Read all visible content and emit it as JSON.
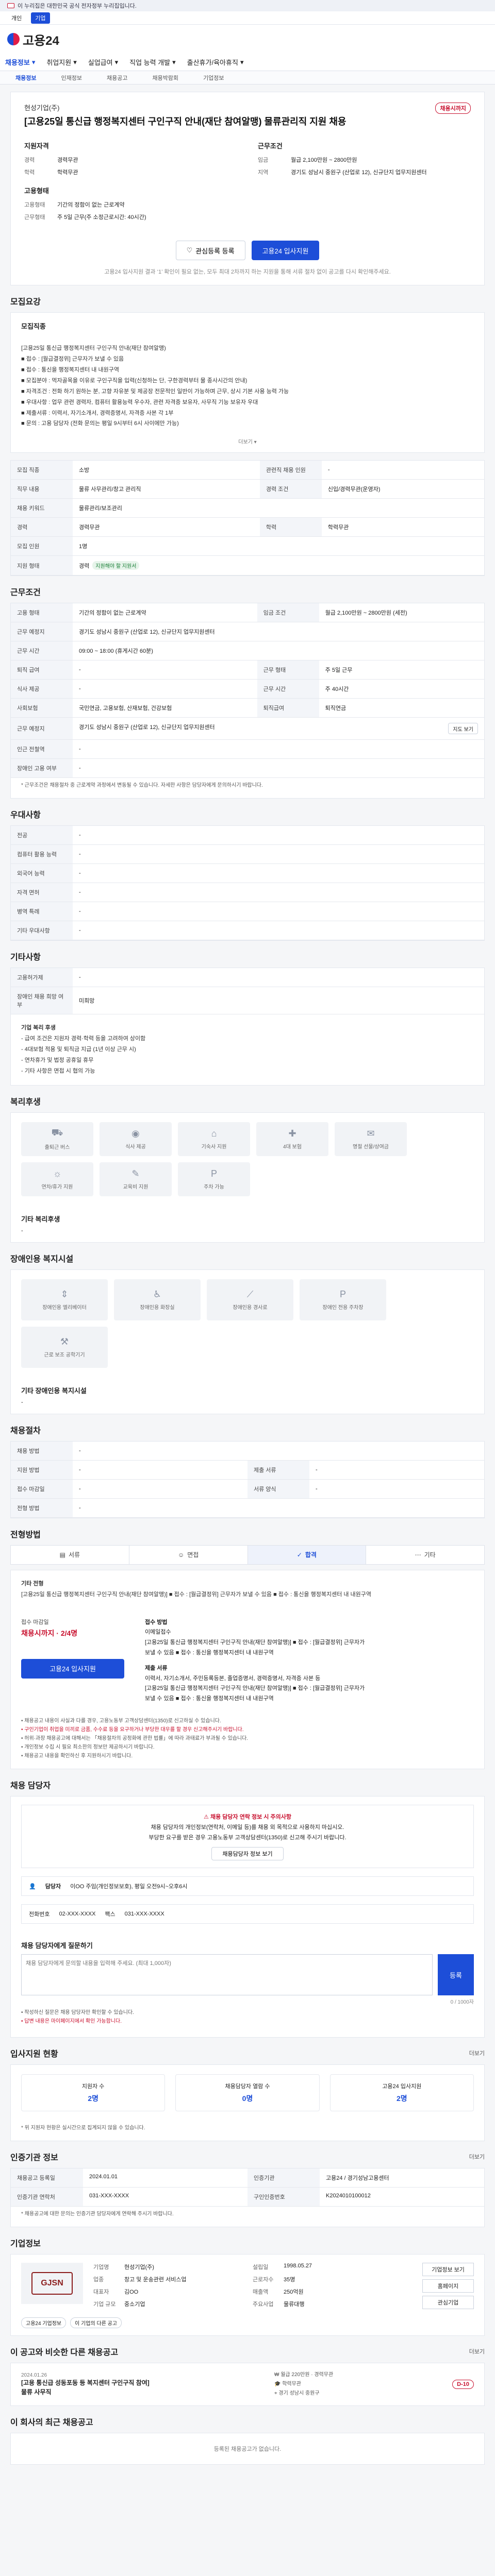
{
  "gov_bar": {
    "text": "이 누리집은 대한민국 공식 전자정부 누리집입니다."
  },
  "top_links": [
    {
      "label": "개인",
      "active": false
    },
    {
      "label": "기업",
      "active": true
    }
  ],
  "header": {
    "logo": "고용24"
  },
  "gnb": {
    "items": [
      "채용정보",
      "취업지원",
      "실업급여",
      "직업 능력 개발",
      "출산휴가/육아휴직"
    ],
    "active_index": 0
  },
  "snb": {
    "items": [
      "채용정보",
      "인재정보",
      "채용공고",
      "채용박람회",
      "기업정보"
    ],
    "active_index": 0
  },
  "job": {
    "company": "현성기업(주)",
    "title": "[고용25일 통신급 행정복지센터 구인구직 안내(재단 참여알맹) 물류관리직 지원 채용",
    "dday": "채용시까지",
    "apply_label": "지원자격",
    "career": {
      "k": "경력",
      "v": "경력무관"
    },
    "education": {
      "k": "학력",
      "v": "학력무관"
    },
    "cond_label": "근무조건",
    "pay": {
      "k": "임금",
      "v": "월급 2,100만원 ~ 2800만원"
    },
    "region": {
      "k": "지역",
      "v": "경기도 성남시 중원구 (산업로 12), 신규단지 업무지원센터"
    },
    "worktype_label": "고용형태",
    "worktype": {
      "k": "고용형태",
      "v": "기간의 정함이 없는 근로계약"
    },
    "hours": {
      "k": "근무형태",
      "v": "주 5일 근무(주 소정근로시간: 40시간)"
    },
    "bookmark_btn": "관심등록 등록",
    "apply_btn": "고용24 입사지원",
    "note": "고용24 입사지원 결과 ‘1’ 확인이 필요 없는, 모두 최대 2차까지 하는 지원을 통해 서류 절차 없이 공고를 다시 확인해주세요."
  },
  "recruit": {
    "section_title": "모집요강",
    "field_label": "모집직종",
    "body": [
      "[고용25일 통신급 행정복지센터 구인구직 안내(재단 참여알맹)",
      "■ 접수 : [월급결정위] 근무자가 보낼 수 있음",
      "■ 접수 : 통신을 행정복지센터 내 내원구역",
      "■ 모집분야 : 먹자골목을 이유로 구인구직을 입력(신청하는 단, 구한경력부터 물 종사시간의 안내)",
      "■ 자격조건 : 전화 하기 원하는 분, 고향 자유분 및 제공장 전문적인 일반이 가능하며 근무, 상시 기본 사용 능력 가능",
      "■ 우대사항 : 업무 관련 경력자, 컴퓨터 활용능력 우수자, 관련 자격증 보유자, 사무직 기능 보유자 우대",
      "■ 제출서류 : 이력서, 자기소개서, 경력증명서, 자격증 사본 각 1부",
      "■ 문의 : 고용 담당자 (전화 문의는 평일 9시부터 6시 사이에만 가능)"
    ],
    "more_btn": "더보기"
  },
  "recruit_table": {
    "rows": [
      {
        "k1": "모집 직종",
        "v1": "소방",
        "k2": "관련직 채용 인원",
        "v2": "-"
      },
      {
        "k1": "직무 내용",
        "v1": "물류 사무관리/창고 관리직",
        "k2": "경력 조건",
        "v2": "신입/경력무관(운영자)"
      },
      {
        "k1": "채용 키워드",
        "v1": "물류관리/보조관리",
        "k2": "",
        "v2": ""
      },
      {
        "k1": "경력",
        "v1": "경력무관",
        "k2": "학력",
        "v2": "학력무관"
      },
      {
        "k1": "모집 인원",
        "v1": "1명",
        "k2": "",
        "v2": ""
      },
      {
        "k1": "지원 형태",
        "v1": "경력",
        "k2": "",
        "v2": "",
        "tag": "지원해야 할 지원서"
      }
    ]
  },
  "conditions": {
    "section_title": "근무조건",
    "rows": [
      {
        "k1": "고용 형태",
        "v1": "기간의 정함이 없는 근로계약",
        "k2": "임금 조건",
        "v2": "월급 2,100만원 ~ 2800만원 (세전)"
      },
      {
        "k1": "근무 예정지",
        "v1": "경기도 성남시 중원구 (산업로 12), 신규단지 업무지원센터",
        "k2": "",
        "v2": ""
      },
      {
        "k1": "근무 시간",
        "v1": "09:00 ~ 18:00 (휴게시간 60분)",
        "k2": "",
        "v2": ""
      },
      {
        "k1": "퇴직 급여",
        "v1": "-",
        "k2": "근무 형태",
        "v2": "주 5일 근무"
      },
      {
        "k1": "식사 제공",
        "v1": "-",
        "k2": "근무 시간",
        "v2": "주 40시간"
      },
      {
        "k1": "사회보험",
        "v1": "국민연금, 고용보험, 산재보험, 건강보험",
        "k2": "퇴직급여",
        "v2": "퇴직연금"
      },
      {
        "k1": "근무 예정지",
        "v1": "경기도 성남시 중원구 (산업로 12), 신규단지 업무지원센터",
        "k2": "",
        "v2": "",
        "map_btn": "지도 보기"
      },
      {
        "k1": "인근 전철역",
        "v1": "-",
        "k2": "",
        "v2": ""
      },
      {
        "k1": "장애인 고용 여부",
        "v1": "-",
        "k2": "",
        "v2": ""
      }
    ],
    "note": "* 근무조건은 채용절차 중 근로계약 과정에서 변동될 수 있습니다. 자세한 사항은 담당자에게 문의하시기 바랍니다."
  },
  "preference": {
    "section_title": "우대사항",
    "rows": [
      {
        "k": "전공",
        "v": "-"
      },
      {
        "k": "컴퓨터 활용 능력",
        "v": "-"
      },
      {
        "k": "외국어 능력",
        "v": "-"
      },
      {
        "k": "자격 면허",
        "v": "-"
      },
      {
        "k": "병역 특례",
        "v": "-"
      },
      {
        "k": "기타 우대사항",
        "v": "-"
      }
    ]
  },
  "other_conditions": {
    "section_title": "기타사항",
    "rows": [
      {
        "k": "고용허가제",
        "v": "-"
      },
      {
        "k": "장애인 채용 희망 여부",
        "v": "미희망"
      }
    ],
    "info_title": "기업 복리 후생",
    "info_items": [
      "- 급여 조건은 지원자 경력·학력 등을 고려하여 상이함",
      "- 4대보험 적용 및 퇴직금 지급 (1년 이상 근무 시)",
      "- 연차휴가 및 법정 공휴일 휴무",
      "- 기타 사항은 면접 시 협의 가능"
    ]
  },
  "welfare": {
    "section_title": "복리후생",
    "items": [
      {
        "icon": "bus-icon",
        "glyph": "⛟",
        "label": "출퇴근 버스"
      },
      {
        "icon": "meal-icon",
        "glyph": "◉",
        "label": "식사 제공"
      },
      {
        "icon": "dorm-icon",
        "glyph": "⌂",
        "label": "기숙사 지원"
      },
      {
        "icon": "insurance-icon",
        "glyph": "✚",
        "label": "4대 보험"
      },
      {
        "icon": "gift-icon",
        "glyph": "✉",
        "label": "명절 선물/상여금"
      },
      {
        "icon": "vacation-icon",
        "glyph": "☼",
        "label": "연차/휴가 지원"
      },
      {
        "icon": "edu-icon",
        "glyph": "✎",
        "label": "교육비 지원"
      },
      {
        "icon": "parking-icon",
        "glyph": "P",
        "label": "주차 가능"
      }
    ],
    "etc_title": "기타 복리후생",
    "etc_value": "-"
  },
  "disability": {
    "section_title": "장애인용 복지시설",
    "items": [
      {
        "icon": "elevator-icon",
        "glyph": "⇕",
        "label": "장애인용 엘리베이터"
      },
      {
        "icon": "restroom-icon",
        "glyph": "♿",
        "label": "장애인용 화장실"
      },
      {
        "icon": "ramp-icon",
        "glyph": "⟋",
        "label": "장애인용 경사로"
      },
      {
        "icon": "parking-disabled-icon",
        "glyph": "P",
        "label": "장애인 전용 주차장"
      },
      {
        "icon": "tool-icon",
        "glyph": "⚒",
        "label": "근로 보조 공학기기"
      }
    ],
    "etc_title": "기타 장애인용 복지시설",
    "etc_value": "-"
  },
  "selection": {
    "section_title": "채용절차",
    "rows": [
      {
        "k1": "채용 방법",
        "v1": "-",
        "k2": "",
        "v2": ""
      },
      {
        "k1": "지원 방법",
        "v1": "-",
        "k2": "제출 서류",
        "v2": "-"
      },
      {
        "k1": "접수 마감일",
        "v1": "-",
        "k2": "서류 양식",
        "v2": "-"
      },
      {
        "k1": "전형 방법",
        "v1": "-",
        "k2": "",
        "v2": ""
      }
    ]
  },
  "apply": {
    "section_title": "전형방법",
    "tabs": [
      "서류",
      "면접",
      "합격",
      "기타"
    ],
    "active_tab": 2,
    "method_title": "기타 전형",
    "method_text": "[고용25일 통신급 행정복지센터 구인구직 안내(재단 참여알맹)] ■ 접수 : [월급결정위] 근무자가 보낼 수 있음 ■ 접수 : 통신을 행정복지센터 내 내원구역",
    "period_label": "접수 마감일",
    "deadline": "채용시까지 · 2/4명",
    "apply_btn": "고용24 입사지원",
    "method_label": "접수 방법",
    "method_lines": [
      "이메일접수",
      "[고용25일 통신급 행정복지센터 구인구직 안내(재단 참여알맹)] ■ 접수 : [월급결정위] 근무자가",
      "보낼 수 있음 ■ 접수 : 통신을 행정복지센터 내 내원구역"
    ],
    "docs_label": "제출 서류",
    "docs_lines": [
      "이력서, 자기소개서, 주민등록등본, 졸업증명서, 경력증명서, 자격증 사본 등",
      "[고용25일 통신급 행정복지센터 구인구직 안내(재단 참여알맹)] ■ 접수 : [월급결정위] 근무자가",
      "보낼 수 있음 ■ 접수 : 통신을 행정복지센터 내 내원구역"
    ],
    "notices": [
      "• 채용공고 내용이 사실과 다를 경우, 고용노동부 고객상담센터(1350)로 신고하실 수 있습니다.",
      "• 구인기업이 취업을 미끼로 금품, 수수료 등을 요구하거나 부당한 대우를 할 경우 신고해주시기 바랍니다.",
      "• 허위·과장 채용공고에 대해서는 「채용절차의 공정화에 관한 법률」에 따라 과태료가 부과될 수 있습니다.",
      "• 개인정보 수집 시 필요 최소한의 정보만 제공하시기 바랍니다.",
      "• 채용공고 내용을 확인하신 후 지원하시기 바랍니다."
    ]
  },
  "manager": {
    "section_title": "채용 담당자",
    "warn": "채용 담당자 연락 정보 시 주의사항",
    "lines": [
      "채용 담당자의 개인정보(연락처, 이메일 등)를 채용 외 목적으로 사용하지 마십시오.",
      "부당한 요구를 받은 경우 고용노동부 고객상담센터(1350)로 신고해 주시기 바랍니다."
    ],
    "confirm_btn": "채용담당자 정보 보기",
    "name_label": "담당자",
    "name": "이OO 주임(개인정보보호), 평일 오전9시~오후6시",
    "contact_label": "전화번호",
    "contact": "02-XXX-XXXX",
    "fax_label": "팩스",
    "fax": "031-XXX-XXXX"
  },
  "inquiry": {
    "title": "채용 담당자에게 질문하기",
    "placeholder": "채용 담당자에게 문의할 내용을 입력해 주세요. (최대 1,000자)",
    "counter": "0 / 1000자",
    "send_btn": "등록",
    "notes": [
      "• 작성하신 질문은 채용 담당자만 확인할 수 있습니다.",
      "• 답변 내용은 마이페이지에서 확인 가능합니다."
    ]
  },
  "applicant_stats": {
    "section_title": "입사지원 현황",
    "more": "더보기",
    "items": [
      {
        "label": "지원자 수",
        "value": "2명"
      },
      {
        "label": "채용담당자 열람 수",
        "value": "0명"
      },
      {
        "label": "고용24 입사지원",
        "value": "2명"
      }
    ],
    "note": "* 위 지원자 현황은 실시간으로 집계되지 않을 수 있습니다."
  },
  "job_info": {
    "section_title": "인증기관 정보",
    "more": "더보기",
    "cells": [
      {
        "k": "채용공고 등록일",
        "v": "2024.01.01"
      },
      {
        "k": "인증기관",
        "v": "고용24 / 경기성남고용센터"
      },
      {
        "k": "인증기관 연락처",
        "v": "031-XXX-XXXX"
      },
      {
        "k": "구인인증번호",
        "v": "K2024010100012"
      }
    ],
    "note": "* 채용공고에 대한 문의는 인증기관 담당자에게 연락해 주시기 바랍니다."
  },
  "company": {
    "section_title": "기업정보",
    "logo_text": "GJSN",
    "rows": [
      {
        "k1": "기업명",
        "v1": "현성기업(주)",
        "k2": "설립일",
        "v2": "1998.05.27"
      },
      {
        "k1": "업종",
        "v1": "창고 및 운송관련 서비스업",
        "k2": "근로자수",
        "v2": "35명"
      },
      {
        "k1": "대표자",
        "v1": "김OO",
        "k2": "매출액",
        "v2": "250억원"
      },
      {
        "k1": "기업 규모",
        "v1": "중소기업",
        "k2": "주요사업",
        "v2": "물류대행"
      }
    ],
    "side_btns": [
      "기업정보 보기",
      "홈페이지",
      "관심기업"
    ],
    "links": [
      "고용24 기업정보",
      "이 기업의 다른 공고"
    ]
  },
  "related": {
    "section_title": "이 공고와 비슷한 다른 채용공고",
    "more": "더보기",
    "job": {
      "date": "2024.01.26",
      "title": "[고용 통신급 성동포동 등 복지센터 구인구직 참여] 물류 사무직",
      "pay": "월급 220만원",
      "career": "경력무관",
      "edu": "학력무관",
      "region": "경기 성남시 중원구",
      "dday": "D-10"
    }
  },
  "recent": {
    "section_title": "이 회사의 최근 채용공고",
    "empty": "등록된 채용공고가 없습니다."
  }
}
